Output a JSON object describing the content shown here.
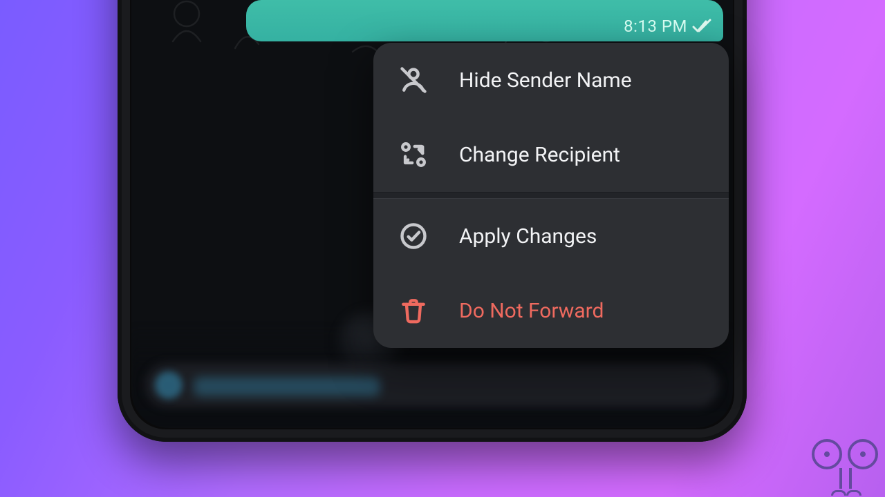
{
  "message": {
    "time": "8:13 PM",
    "status": "read"
  },
  "menu": {
    "items": [
      {
        "label": "Hide Sender Name",
        "icon": "user-off-icon",
        "danger": false
      },
      {
        "label": "Change Recipient",
        "icon": "swap-icon",
        "danger": false
      }
    ],
    "items2": [
      {
        "label": "Apply Changes",
        "icon": "check-circle-icon",
        "danger": false
      },
      {
        "label": "Do Not Forward",
        "icon": "trash-icon",
        "danger": true
      }
    ]
  },
  "colors": {
    "accentBubble": "#38b4a4",
    "menuBg": "#2d2f33",
    "danger": "#ef6a5f"
  }
}
